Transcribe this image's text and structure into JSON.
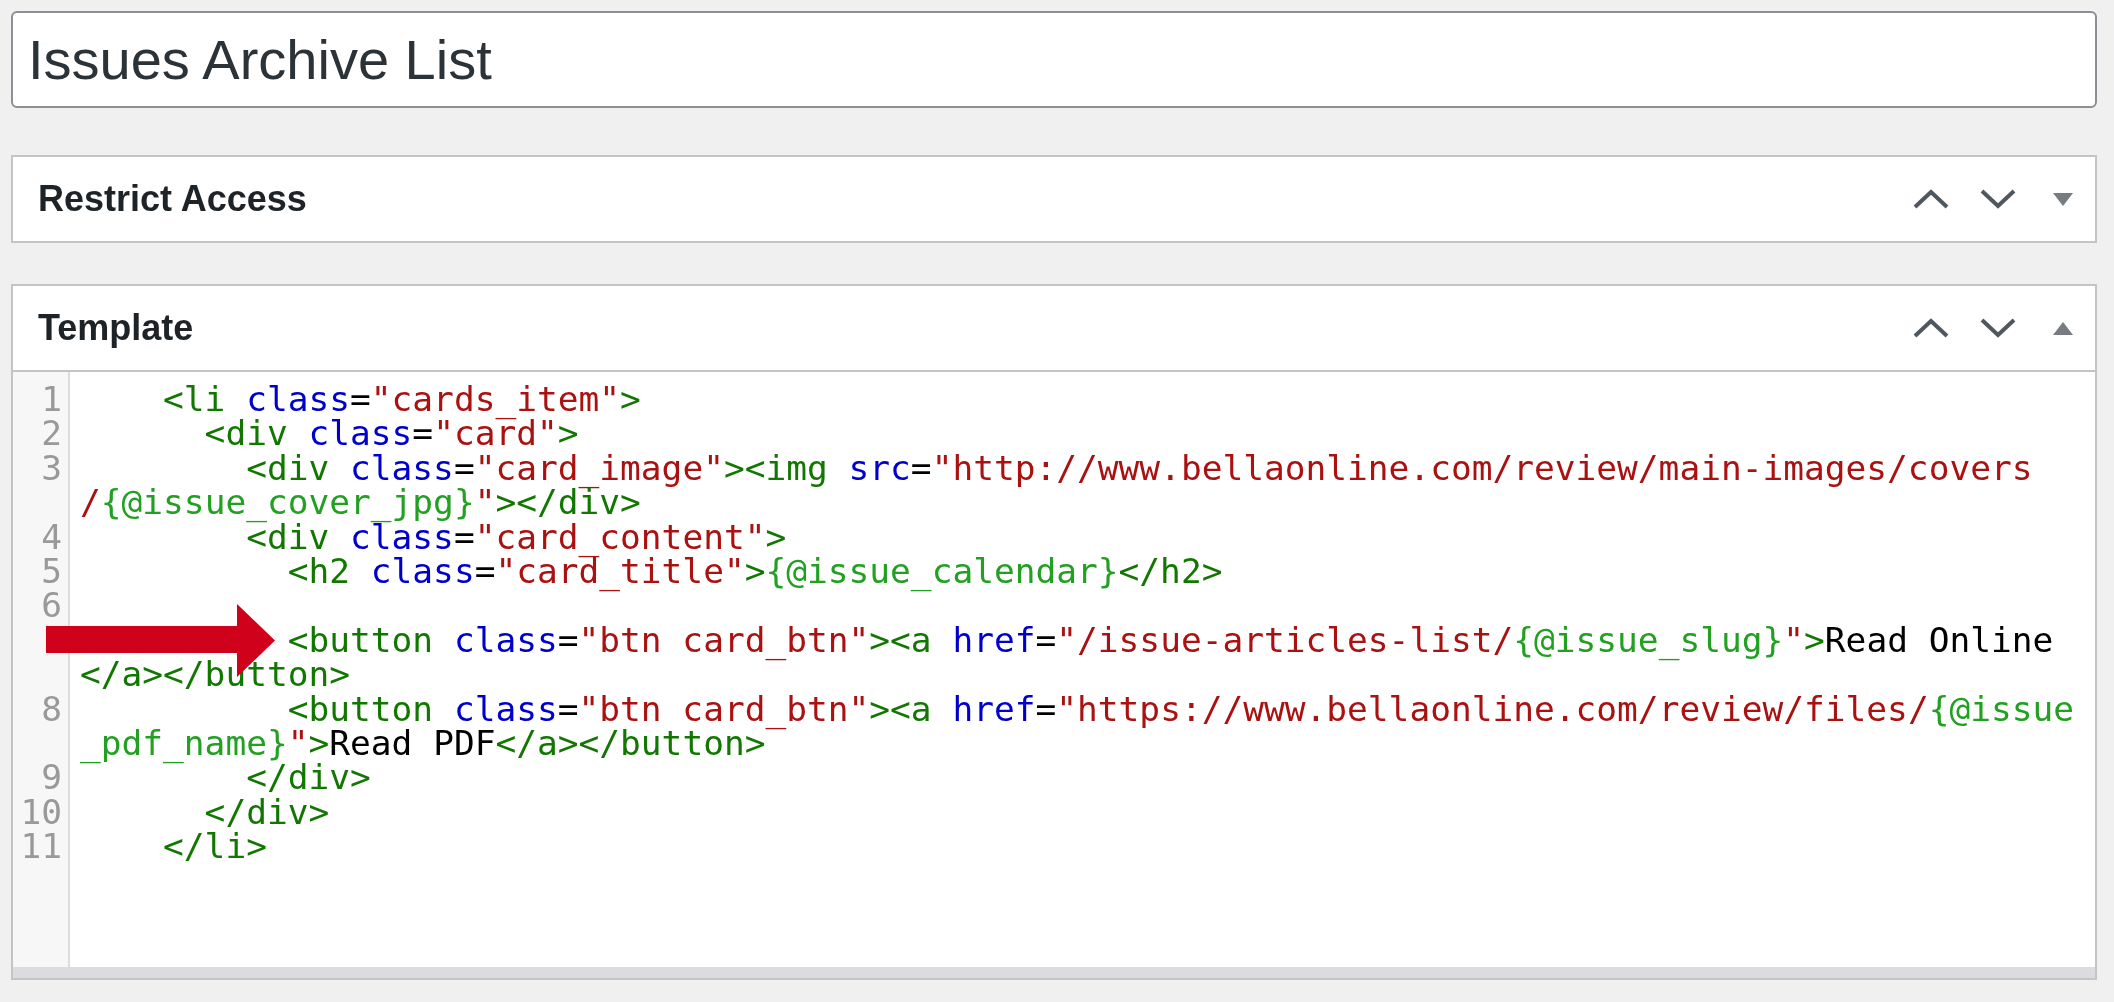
{
  "title_field": {
    "value": "Issues Archive List"
  },
  "panels": [
    {
      "title": "Restrict Access",
      "expanded": false
    },
    {
      "title": "Template",
      "expanded": true,
      "editor": {
        "lines": [
          {
            "number": "1",
            "marked": false,
            "segments": [
              {
                "tokens": [
                  {
                    "kind": "tag",
                    "text": "    <li "
                  },
                  {
                    "kind": "attribute",
                    "text": "class"
                  },
                  {
                    "kind": "plain",
                    "text": "="
                  },
                  {
                    "kind": "string",
                    "text": "\"cards_item\""
                  },
                  {
                    "kind": "tag",
                    "text": ">"
                  }
                ]
              }
            ]
          },
          {
            "number": "2",
            "marked": false,
            "segments": [
              {
                "tokens": [
                  {
                    "kind": "tag",
                    "text": "      <div "
                  },
                  {
                    "kind": "attribute",
                    "text": "class"
                  },
                  {
                    "kind": "plain",
                    "text": "="
                  },
                  {
                    "kind": "string",
                    "text": "\"card\""
                  },
                  {
                    "kind": "tag",
                    "text": ">"
                  }
                ]
              }
            ]
          },
          {
            "number": "3",
            "marked": false,
            "segments": [
              {
                "tokens": [
                  {
                    "kind": "tag",
                    "text": "        <div "
                  },
                  {
                    "kind": "attribute",
                    "text": "class"
                  },
                  {
                    "kind": "plain",
                    "text": "="
                  },
                  {
                    "kind": "string",
                    "text": "\"card_image\""
                  },
                  {
                    "kind": "tag",
                    "text": "><img "
                  },
                  {
                    "kind": "attribute",
                    "text": "src"
                  },
                  {
                    "kind": "plain",
                    "text": "="
                  },
                  {
                    "kind": "string",
                    "text": "\"http://www.bellaonline.com/review/main-images/covers"
                  }
                ]
              },
              {
                "tokens": [
                  {
                    "kind": "string",
                    "text": "/"
                  },
                  {
                    "kind": "variable",
                    "text": "{@issue_cover_jpg}"
                  },
                  {
                    "kind": "string",
                    "text": "\""
                  },
                  {
                    "kind": "tag",
                    "text": "></div>"
                  }
                ]
              }
            ]
          },
          {
            "number": "4",
            "marked": false,
            "segments": [
              {
                "tokens": [
                  {
                    "kind": "tag",
                    "text": "        <div "
                  },
                  {
                    "kind": "attribute",
                    "text": "class"
                  },
                  {
                    "kind": "plain",
                    "text": "="
                  },
                  {
                    "kind": "string",
                    "text": "\"card_content\""
                  },
                  {
                    "kind": "tag",
                    "text": ">"
                  }
                ]
              }
            ]
          },
          {
            "number": "5",
            "marked": false,
            "segments": [
              {
                "tokens": [
                  {
                    "kind": "tag",
                    "text": "          <h2 "
                  },
                  {
                    "kind": "attribute",
                    "text": "class"
                  },
                  {
                    "kind": "plain",
                    "text": "="
                  },
                  {
                    "kind": "string",
                    "text": "\"card_title\""
                  },
                  {
                    "kind": "tag",
                    "text": ">"
                  },
                  {
                    "kind": "variable",
                    "text": "{@issue_calendar}"
                  },
                  {
                    "kind": "tag",
                    "text": "</h2>"
                  }
                ]
              }
            ]
          },
          {
            "number": "6",
            "marked": false
          },
          {
            "marked": true,
            "segments": [
              {
                "tokens": [
                  {
                    "kind": "tag",
                    "text": "          <button "
                  },
                  {
                    "kind": "attribute",
                    "text": "class"
                  },
                  {
                    "kind": "plain",
                    "text": "="
                  },
                  {
                    "kind": "string",
                    "text": "\"btn card_btn\""
                  },
                  {
                    "kind": "tag",
                    "text": "><a "
                  },
                  {
                    "kind": "attribute",
                    "text": "href"
                  },
                  {
                    "kind": "plain",
                    "text": "="
                  },
                  {
                    "kind": "string",
                    "text": "\"/issue-articles-list/"
                  },
                  {
                    "kind": "variable",
                    "text": "{@issue_slug}"
                  },
                  {
                    "kind": "string",
                    "text": "\""
                  },
                  {
                    "kind": "tag",
                    "text": ">"
                  },
                  {
                    "kind": "plain",
                    "text": "Read Online"
                  }
                ]
              },
              {
                "tokens": [
                  {
                    "kind": "tag",
                    "text": "</a></button>"
                  }
                ]
              }
            ]
          },
          {
            "number": "8",
            "marked": false,
            "segments": [
              {
                "tokens": [
                  {
                    "kind": "tag",
                    "text": "          <button "
                  },
                  {
                    "kind": "attribute",
                    "text": "class"
                  },
                  {
                    "kind": "plain",
                    "text": "="
                  },
                  {
                    "kind": "string",
                    "text": "\"btn card_btn\""
                  },
                  {
                    "kind": "tag",
                    "text": "><a "
                  },
                  {
                    "kind": "attribute",
                    "text": "href"
                  },
                  {
                    "kind": "plain",
                    "text": "="
                  },
                  {
                    "kind": "string",
                    "text": "\"https://www.bellaonline.com/review/files/"
                  },
                  {
                    "kind": "variable",
                    "text": "{@issue"
                  }
                ]
              },
              {
                "tokens": [
                  {
                    "kind": "variable",
                    "text": "_pdf_name}"
                  },
                  {
                    "kind": "string",
                    "text": "\""
                  },
                  {
                    "kind": "tag",
                    "text": ">"
                  },
                  {
                    "kind": "plain",
                    "text": "Read PDF"
                  },
                  {
                    "kind": "tag",
                    "text": "</a></button>"
                  }
                ]
              }
            ]
          },
          {
            "number": "9",
            "marked": false,
            "segments": [
              {
                "tokens": [
                  {
                    "kind": "tag",
                    "text": "        </div>"
                  }
                ]
              }
            ]
          },
          {
            "number": "10",
            "marked": false,
            "segments": [
              {
                "tokens": [
                  {
                    "kind": "tag",
                    "text": "      </div>"
                  }
                ]
              }
            ]
          },
          {
            "number": "11",
            "marked": false,
            "segments": [
              {
                "tokens": [
                  {
                    "kind": "tag",
                    "text": "    </li>"
                  }
                ]
              }
            ]
          }
        ]
      }
    }
  ]
}
